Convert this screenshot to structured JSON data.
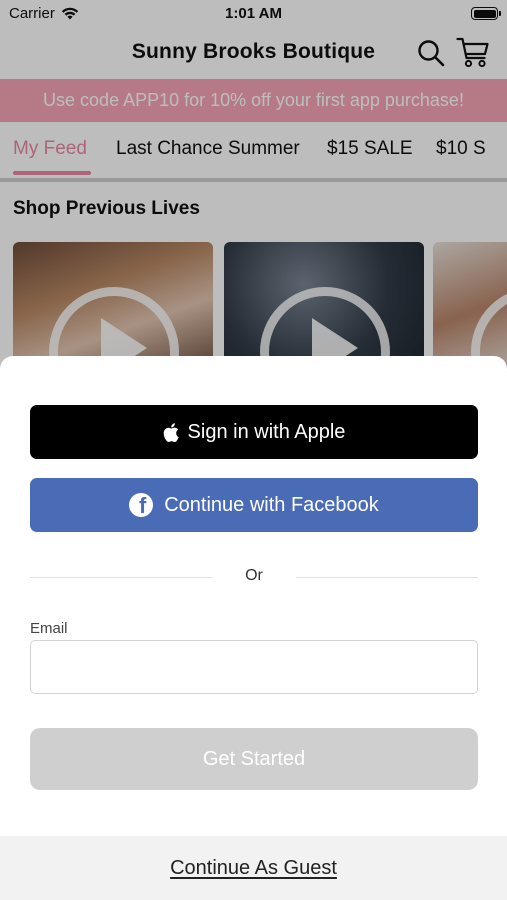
{
  "status_bar": {
    "carrier": "Carrier",
    "time": "1:01 AM"
  },
  "header": {
    "title": "Sunny Brooks Boutique"
  },
  "promo": {
    "text": "Use code APP10 for 10% off your first app purchase!"
  },
  "tabs": [
    {
      "label": "My Feed",
      "active": true
    },
    {
      "label": "Last Chance Summer",
      "active": false
    },
    {
      "label": "$15 SALE",
      "active": false
    },
    {
      "label": "$10 S",
      "active": false
    }
  ],
  "section": {
    "title": "Shop Previous Lives"
  },
  "auth": {
    "apple_label": "Sign in with Apple",
    "facebook_label": "Continue with Facebook",
    "or_text": "Or",
    "email_label": "Email",
    "email_value": "",
    "email_placeholder": "",
    "get_started_label": "Get Started",
    "guest_label": "Continue As Guest"
  },
  "colors": {
    "accent_pink": "#e889a2",
    "promo_bg": "#f6a5b6",
    "facebook_blue": "#4a6bb5",
    "apple_black": "#000000",
    "disabled_gray": "#cfcfcf"
  },
  "icons": {
    "wifi": "wifi-icon",
    "battery": "battery-icon",
    "search": "search-icon",
    "cart": "cart-icon",
    "apple": "apple-logo-icon",
    "facebook": "facebook-logo-icon",
    "play": "play-icon"
  }
}
